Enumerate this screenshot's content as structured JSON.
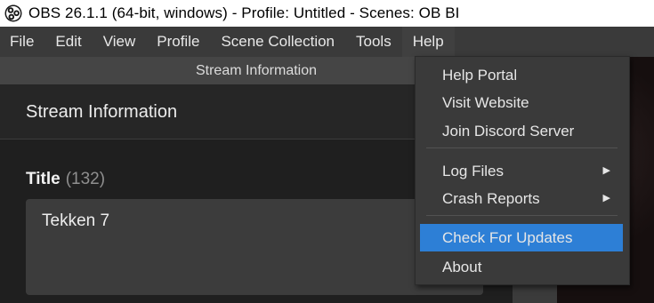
{
  "window": {
    "title": "OBS 26.1.1 (64-bit, windows) - Profile: Untitled - Scenes: OB BI",
    "logo_icon": "obs-logo-icon"
  },
  "menubar": {
    "items": [
      "File",
      "Edit",
      "View",
      "Profile",
      "Scene Collection",
      "Tools",
      "Help"
    ],
    "active": "Help"
  },
  "dock": {
    "title": "Stream Information"
  },
  "dialog": {
    "heading": "Stream Information",
    "title_label": "Title",
    "title_count": "(132)",
    "title_value": "Tekken 7"
  },
  "help_menu": {
    "group1": [
      "Help Portal",
      "Visit Website",
      "Join Discord Server"
    ],
    "group2": [
      {
        "label": "Log Files",
        "submenu": true
      },
      {
        "label": "Crash Reports",
        "submenu": true
      }
    ],
    "group3": [
      "Check For Updates",
      "About"
    ],
    "highlighted": "Check For Updates",
    "submenu_icon": "chevron-right-icon"
  },
  "colors": {
    "highlight": "#2d7fd6",
    "menu_bg": "#3a3a3a",
    "titlebar_bg": "#ffffff"
  }
}
